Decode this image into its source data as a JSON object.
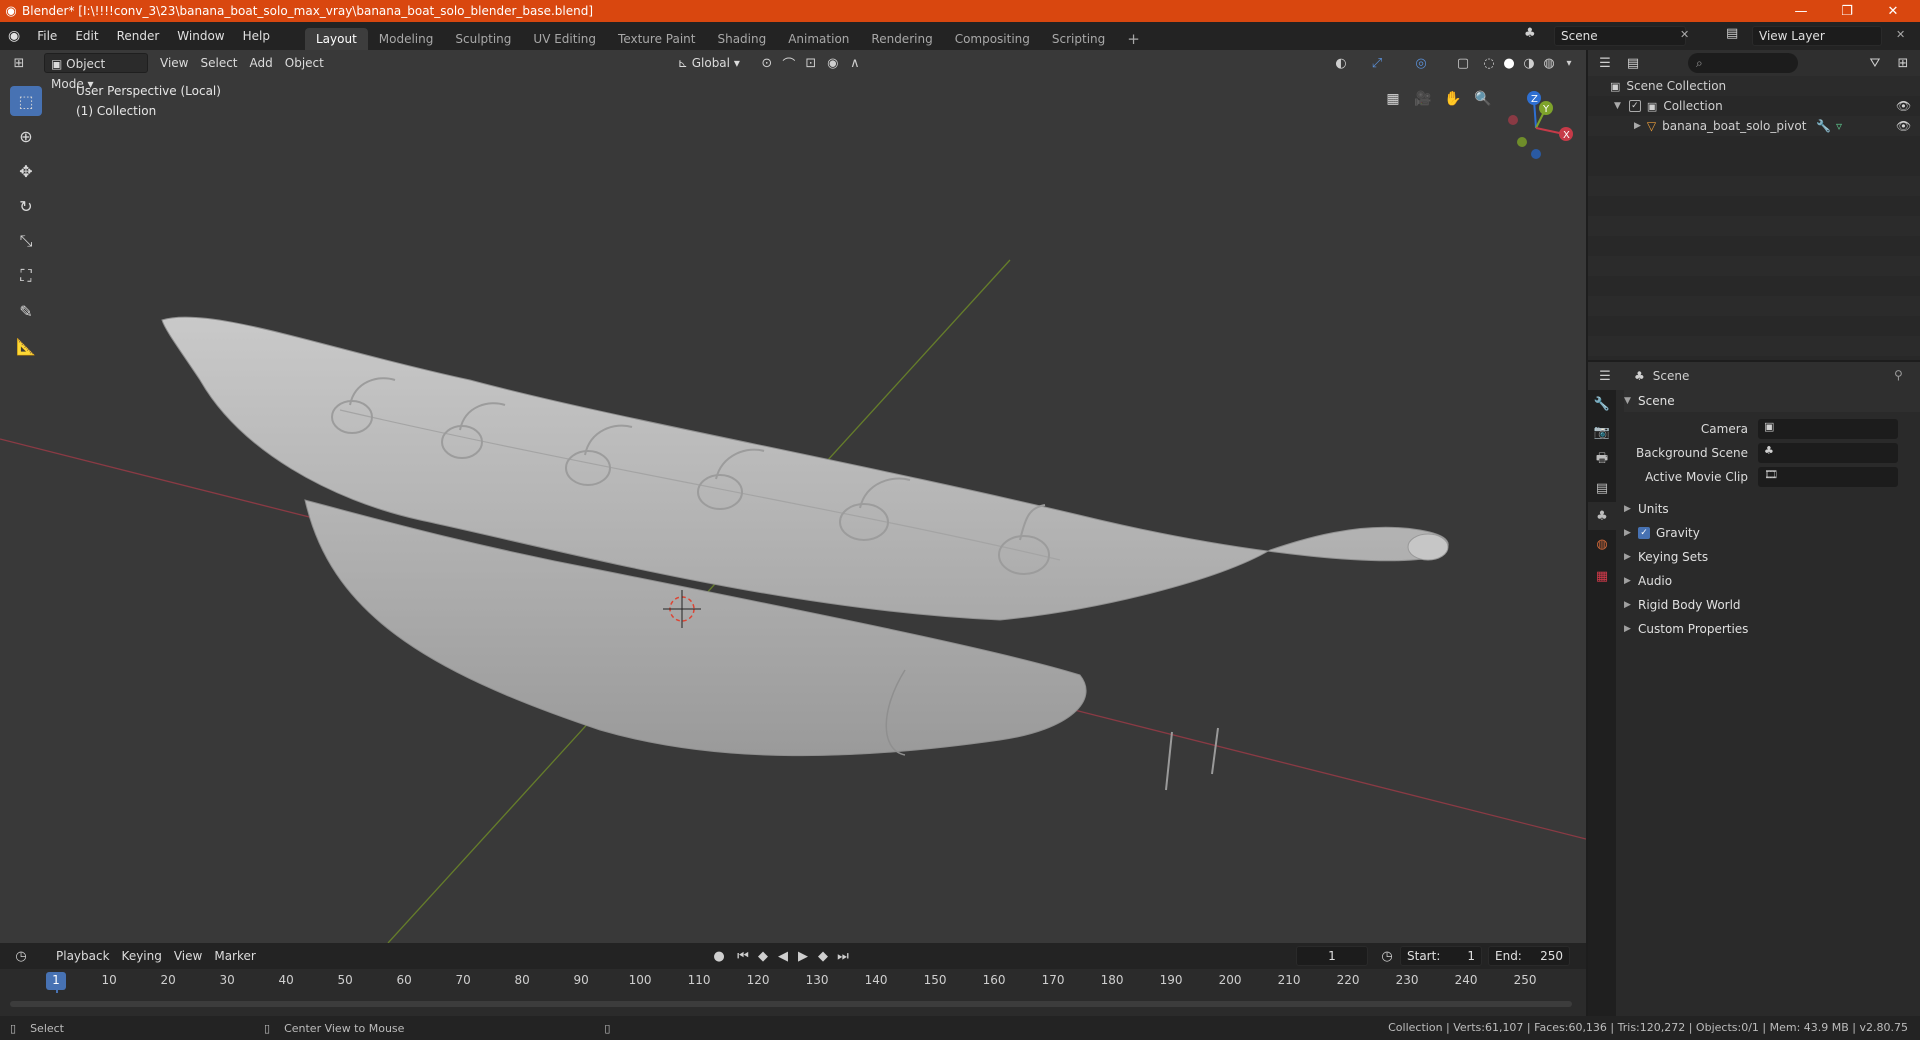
{
  "window": {
    "title": "Blender* [I:\\!!!!conv_3\\23\\banana_boat_solo_max_vray\\banana_boat_solo_blender_base.blend]",
    "minimize": "—",
    "maximize": "❐",
    "close": "✕"
  },
  "menubar": {
    "items": [
      "File",
      "Edit",
      "Render",
      "Window",
      "Help"
    ],
    "workspaces": [
      "Layout",
      "Modeling",
      "Sculpting",
      "UV Editing",
      "Texture Paint",
      "Shading",
      "Animation",
      "Rendering",
      "Compositing",
      "Scripting"
    ],
    "active_workspace": "Layout",
    "add_workspace": "+",
    "scene": "Scene",
    "view_layer": "View Layer"
  },
  "viewport": {
    "mode": "Object Mode",
    "menus": [
      "View",
      "Select",
      "Add",
      "Object"
    ],
    "orientation": "Global",
    "overlay_line1": "User Perspective (Local)",
    "overlay_line2": "(1) Collection",
    "gizmo_axes": {
      "x": "X",
      "y": "Y",
      "z": "Z"
    }
  },
  "outliner": {
    "root": "Scene Collection",
    "collection": "Collection",
    "object": "banana_boat_solo_pivot"
  },
  "properties": {
    "header": "Scene",
    "panel": "Scene",
    "camera_label": "Camera",
    "background_scene_label": "Background Scene",
    "active_movie_clip_label": "Active Movie Clip",
    "subpanels": [
      "Units",
      "Gravity",
      "Keying Sets",
      "Audio",
      "Rigid Body World",
      "Custom Properties"
    ],
    "gravity_checked": true
  },
  "timeline": {
    "menus": [
      "Playback",
      "Keying",
      "View",
      "Marker"
    ],
    "current_frame": "1",
    "start_label": "Start:",
    "start": "1",
    "end_label": "End:",
    "end": "250",
    "ruler": [
      "1",
      "10",
      "20",
      "30",
      "40",
      "50",
      "60",
      "70",
      "80",
      "90",
      "100",
      "110",
      "120",
      "130",
      "140",
      "150",
      "160",
      "170",
      "180",
      "190",
      "200",
      "210",
      "220",
      "230",
      "240",
      "250"
    ]
  },
  "statusbar": {
    "left_action": "Select",
    "middle_action": "Center View to Mouse",
    "stats": "Collection | Verts:61,107 | Faces:60,136 | Tris:120,272 | Objects:0/1 | Mem: 43.9 MB | v2.80.75"
  },
  "colors": {
    "title_bar": "#d9470f",
    "accent": "#4772b3",
    "x_axis": "#c63a48",
    "y_axis": "#7ea32b",
    "z_axis": "#2e6fd1"
  }
}
